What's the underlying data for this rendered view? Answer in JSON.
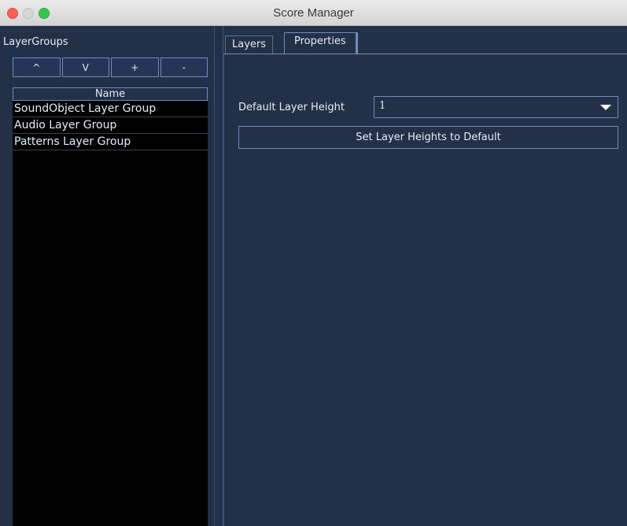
{
  "window": {
    "title": "Score Manager"
  },
  "left_panel": {
    "label": "LayerGroups",
    "buttons": [
      {
        "label": "^"
      },
      {
        "label": "V"
      },
      {
        "label": "+"
      },
      {
        "label": "-"
      }
    ],
    "list": {
      "header": "Name",
      "rows": [
        "SoundObject Layer Group",
        "Audio Layer Group",
        "Patterns Layer Group"
      ]
    }
  },
  "right_panel": {
    "tabs": [
      {
        "label": "Layers",
        "active": false
      },
      {
        "label": "Properties",
        "active": true
      }
    ],
    "default_layer_height_label": "Default Layer Height",
    "default_layer_height_value": "1",
    "set_heights_button": "Set Layer Heights to Default"
  }
}
